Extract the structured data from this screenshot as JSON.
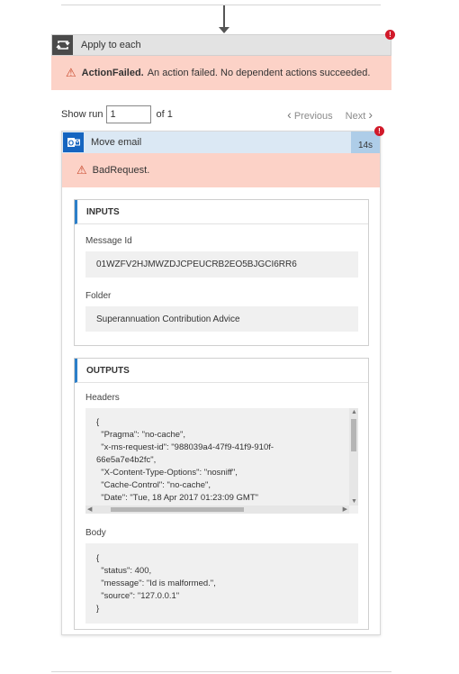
{
  "apply_each": {
    "title": "Apply to each",
    "error_code": "ActionFailed.",
    "error_message": "An action failed. No dependent actions succeeded.",
    "error_badge": "!"
  },
  "pager": {
    "show_run_label": "Show run",
    "run_value": "1",
    "of_label": "of 1",
    "previous_label": "Previous",
    "next_label": "Next",
    "prev_chevron": "‹",
    "next_chevron": "›"
  },
  "move_email": {
    "title": "Move email",
    "duration": "14s",
    "error_badge": "!",
    "error_code": "BadRequest.",
    "inputs": {
      "heading": "INPUTS",
      "message_id_label": "Message Id",
      "message_id_value": "01WZFV2HJMWZDJCPEUCRB2EO5BJGCI6RR6",
      "folder_label": "Folder",
      "folder_value": "Superannuation Contribution Advice"
    },
    "outputs": {
      "heading": "OUTPUTS",
      "headers_label": "Headers",
      "headers_lines": [
        "{",
        "  \"Pragma\": \"no-cache\",",
        "  \"x-ms-request-id\": \"988039a4-47f9-41f9-910f-",
        "66e5a7e4b2fc\",",
        "  \"X-Content-Type-Options\": \"nosniff\",",
        "  \"Cache-Control\": \"no-cache\",",
        "  \"Date\": \"Tue, 18 Apr 2017 01:23:09 GMT\""
      ],
      "body_label": "Body",
      "body_lines": [
        "{",
        "  \"status\": 400,",
        "  \"message\": \"Id is malformed.\",",
        "  \"source\": \"127.0.0.1\"",
        "}"
      ]
    }
  },
  "icons": {
    "warning": "⚠",
    "scroll_up": "▲",
    "scroll_down": "▼",
    "scroll_left": "◀",
    "scroll_right": "▶"
  },
  "colors": {
    "error_background": "#fcd2c7",
    "error_badge": "#d11a2a",
    "outlook_blue": "#1565c0",
    "section_accent": "#2b7fc9"
  }
}
